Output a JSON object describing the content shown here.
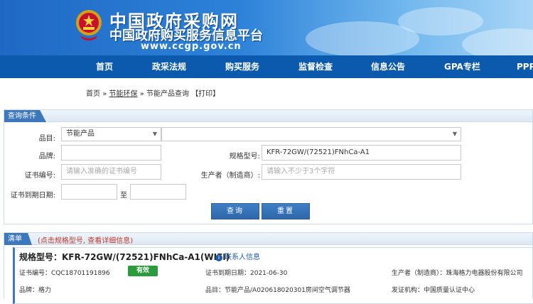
{
  "header": {
    "title": "中国政府采购网",
    "subtitle": "中国政府购买服务信息平台",
    "url": "www.ccgp.gov.cn"
  },
  "nav": {
    "items": [
      "首页",
      "政采法规",
      "购买服务",
      "监督检查",
      "信息公告",
      "GPA专栏",
      "PPP"
    ]
  },
  "breadcrumb": {
    "home": "首页",
    "sep1": "»",
    "section": "节能环保",
    "sep2": "»",
    "page": "节能产品查询",
    "print": "【打印】"
  },
  "query": {
    "tab": "查询条件",
    "category_label": "品目:",
    "category_value": "节能产品",
    "subcategory_value": "",
    "brand_label": "品牌:",
    "brand_value": "",
    "model_label": "规格型号:",
    "model_value": "KFR-72GW/(72521)FNhCa-A1",
    "cert_label": "证书编号:",
    "cert_placeholder": "请输入准确的证书编号",
    "maker_label": "生产者（制造商）:",
    "maker_placeholder": "请输入不少于3个字符",
    "expiry_label": "证书到期日期:",
    "expiry_from": "",
    "to_label": "至",
    "expiry_to": "",
    "search_button": "查询",
    "reset_button": "重置"
  },
  "results": {
    "tab": "清单",
    "note": "(点击规格型号, 查看详细信息)",
    "record": {
      "title": "规格型号：KFR-72GW/(72521)FNhCa-A1(WIFI)",
      "contact": "联系人信息",
      "contact_icon": "info-icon",
      "cert_no": "证书编号：CQC18701191896",
      "status": "有效",
      "expiry": "证书到期日期：2021-06-30",
      "maker": "生产者（制造商）：珠海格力电器股份有限公司",
      "brand": "品牌：格力",
      "category": "品目：节能产品/A020618020301房间空气调节器",
      "issuer": "发证机构：中国质量认证中心"
    }
  },
  "colors": {
    "nav_bg": "#0c5aae",
    "accent": "#3d78bd",
    "status_green": "#2b9b3e",
    "note_red": "#c0392b"
  }
}
